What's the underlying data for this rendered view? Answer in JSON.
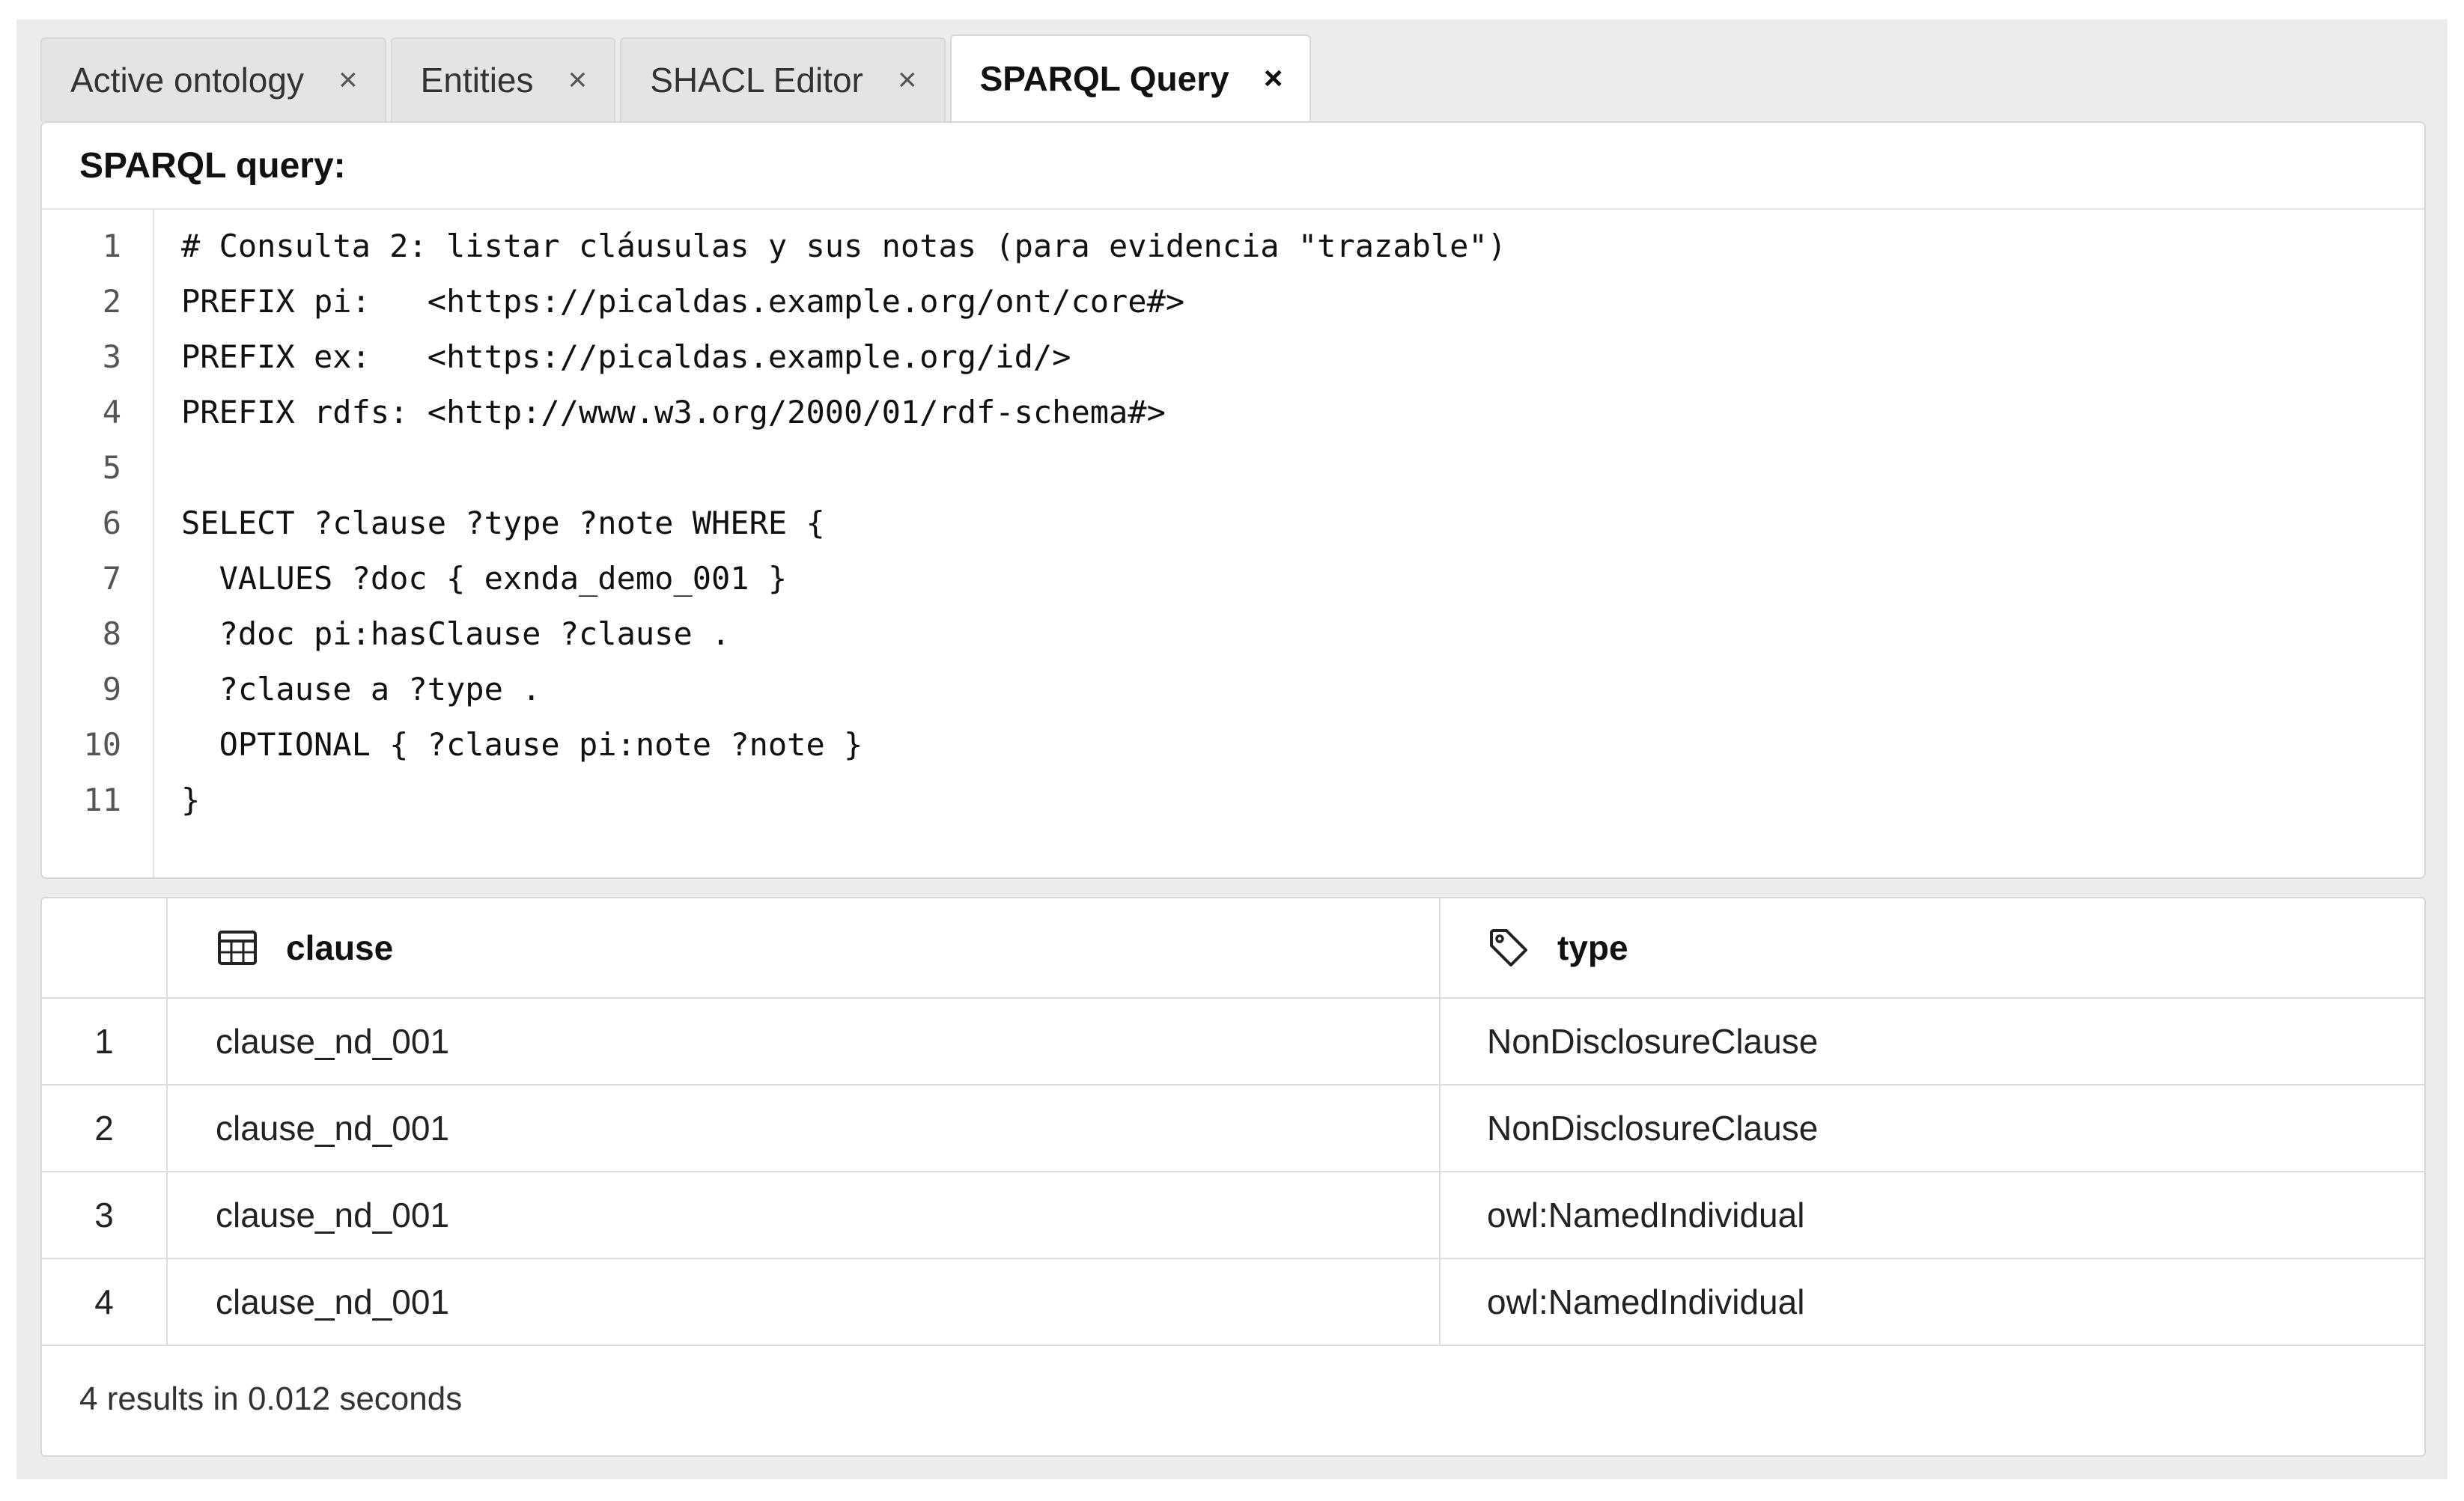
{
  "tabs": [
    {
      "label": "Active ontology",
      "close": "×",
      "active": false
    },
    {
      "label": "Entities",
      "close": "×",
      "active": false
    },
    {
      "label": "SHACL Editor",
      "close": "×",
      "active": false
    },
    {
      "label": "SPARQL Query",
      "close": "×",
      "active": true
    }
  ],
  "query_panel": {
    "title": "SPARQL query:",
    "lines": [
      {
        "no": "1",
        "code": "# Consulta 2: listar cláusulas y sus notas (para evidencia \"trazable\")"
      },
      {
        "no": "2",
        "code": "PREFIX pi:   <https://picaldas.example.org/ont/core#>"
      },
      {
        "no": "3",
        "code": "PREFIX ex:   <https://picaldas.example.org/id/>"
      },
      {
        "no": "4",
        "code": "PREFIX rdfs: <http://www.w3.org/2000/01/rdf-schema#>"
      },
      {
        "no": "5",
        "code": ""
      },
      {
        "no": "6",
        "code": "SELECT ?clause ?type ?note WHERE {"
      },
      {
        "no": "7",
        "code": "  VALUES ?doc { exnda_demo_001 }"
      },
      {
        "no": "8",
        "code": "  ?doc pi:hasClause ?clause ."
      },
      {
        "no": "9",
        "code": "  ?clause a ?type ."
      },
      {
        "no": "10",
        "code": "  OPTIONAL { ?clause pi:note ?note }"
      },
      {
        "no": "11",
        "code": "}"
      }
    ]
  },
  "results": {
    "columns": [
      {
        "label": "clause",
        "icon": "table-icon"
      },
      {
        "label": "type",
        "icon": "tag-icon"
      }
    ],
    "rows": [
      {
        "index": "1",
        "clause": "clause_nd_001",
        "type": "NonDisclosureClause"
      },
      {
        "index": "2",
        "clause": "clause_nd_001",
        "type": "NonDisclosureClause"
      },
      {
        "index": "3",
        "clause": "clause_nd_001",
        "type": "owl:NamedIndividual"
      },
      {
        "index": "4",
        "clause": "clause_nd_001",
        "type": "owl:NamedIndividual"
      }
    ],
    "summary": "4 results in 0.012 seconds"
  }
}
